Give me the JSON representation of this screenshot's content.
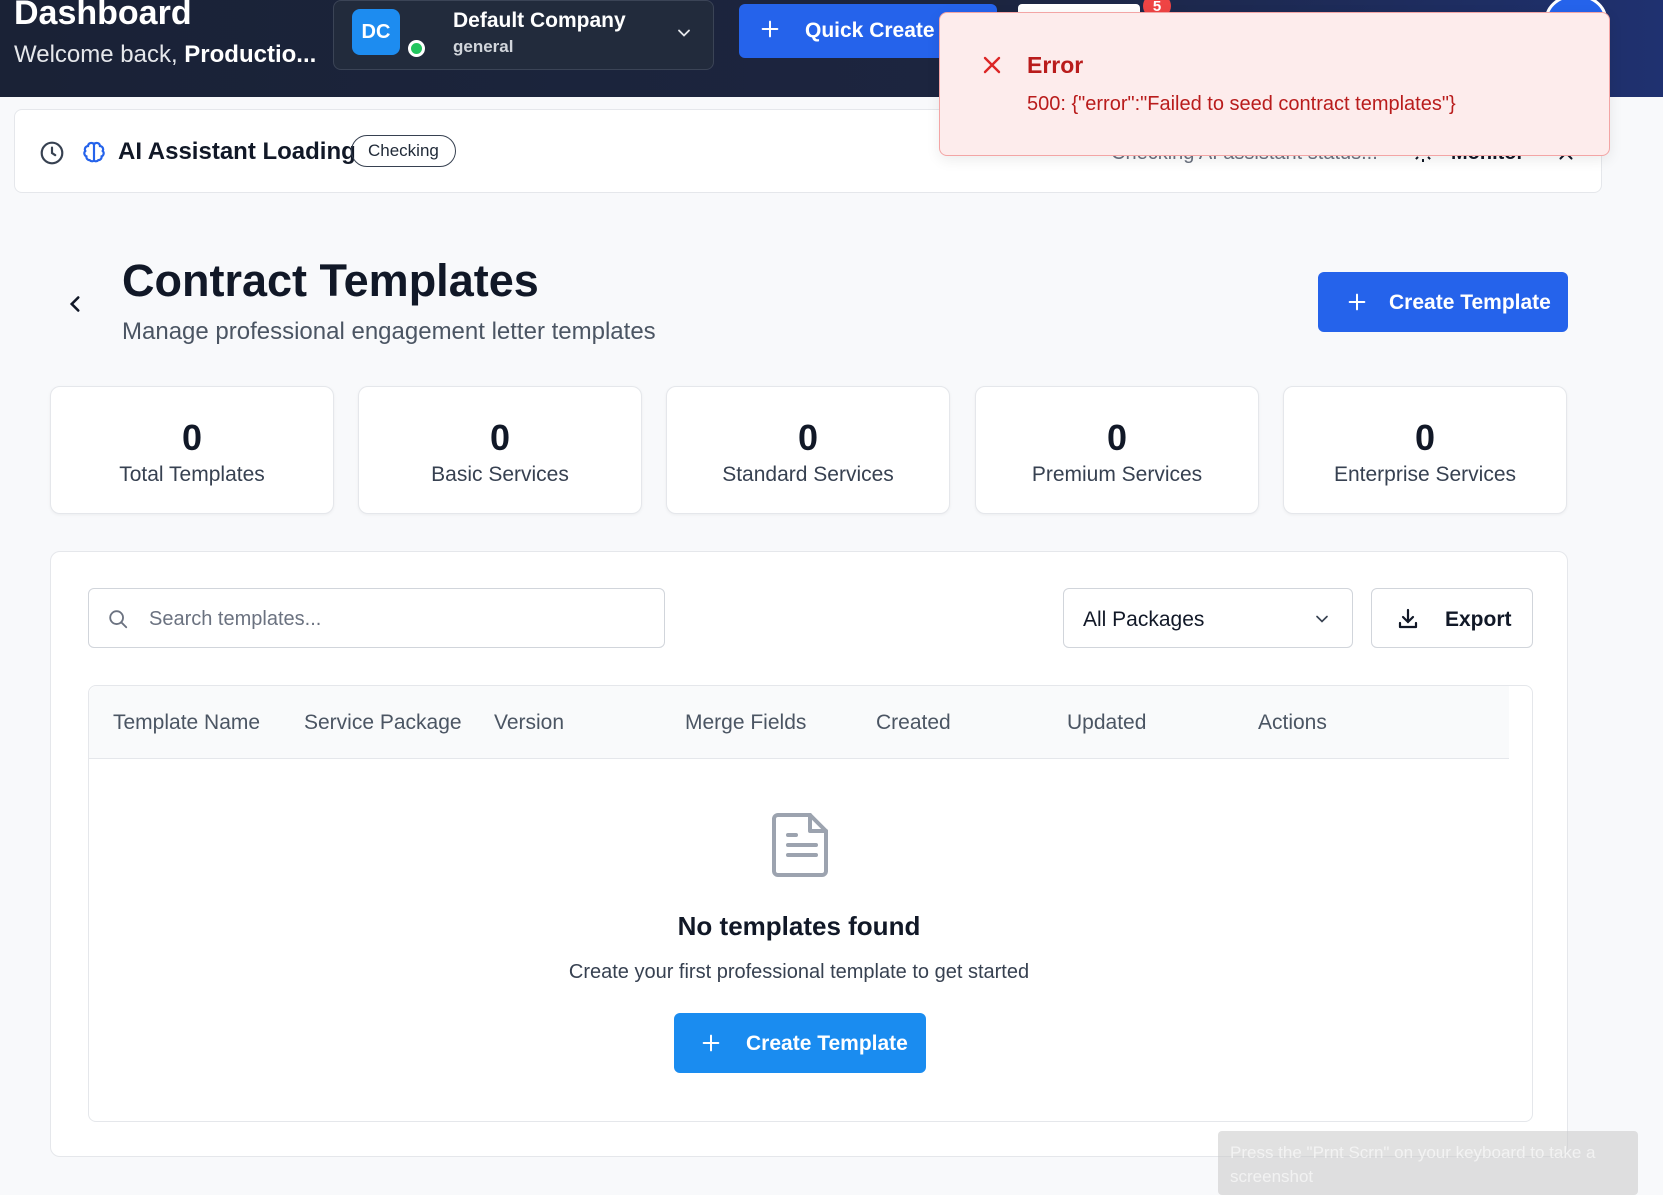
{
  "header": {
    "title": "Dashboard",
    "welcome_prefix": "Welcome back, ",
    "welcome_user": "Productio...",
    "company": {
      "initials": "DC",
      "name": "Default Company",
      "subtitle": "general"
    },
    "quick_create_label": "Quick Create",
    "notification_count": "5"
  },
  "ai_bar": {
    "title": "AI Assistant Loading",
    "badge": "Checking",
    "status_text": "Checking AI assistant status...",
    "monitor_label": "Monitor"
  },
  "toast": {
    "title": "Error",
    "message": "500: {\"error\":\"Failed to seed contract templates\"}"
  },
  "page": {
    "title": "Contract Templates",
    "subtitle": "Manage professional engagement letter templates",
    "create_label": "Create Template"
  },
  "stats": [
    {
      "value": "0",
      "label": "Total Templates"
    },
    {
      "value": "0",
      "label": "Basic Services"
    },
    {
      "value": "0",
      "label": "Standard Services"
    },
    {
      "value": "0",
      "label": "Premium Services"
    },
    {
      "value": "0",
      "label": "Enterprise Services"
    }
  ],
  "toolbar": {
    "search_placeholder": "Search templates...",
    "package_filter": "All Packages",
    "export_label": "Export"
  },
  "table": {
    "columns": [
      "Template Name",
      "Service Package",
      "Version",
      "Merge Fields",
      "Created",
      "Updated",
      "Actions"
    ]
  },
  "empty_state": {
    "title": "No templates found",
    "subtitle": "Create your first professional template to get started",
    "button_label": "Create Template"
  },
  "screenshot_hint": "Press the \"Prnt Scrn\" on your keyboard to take a screenshot",
  "colors": {
    "primary": "#2563eb",
    "error": "#b91c1c",
    "header_bg": "#1a2236"
  }
}
